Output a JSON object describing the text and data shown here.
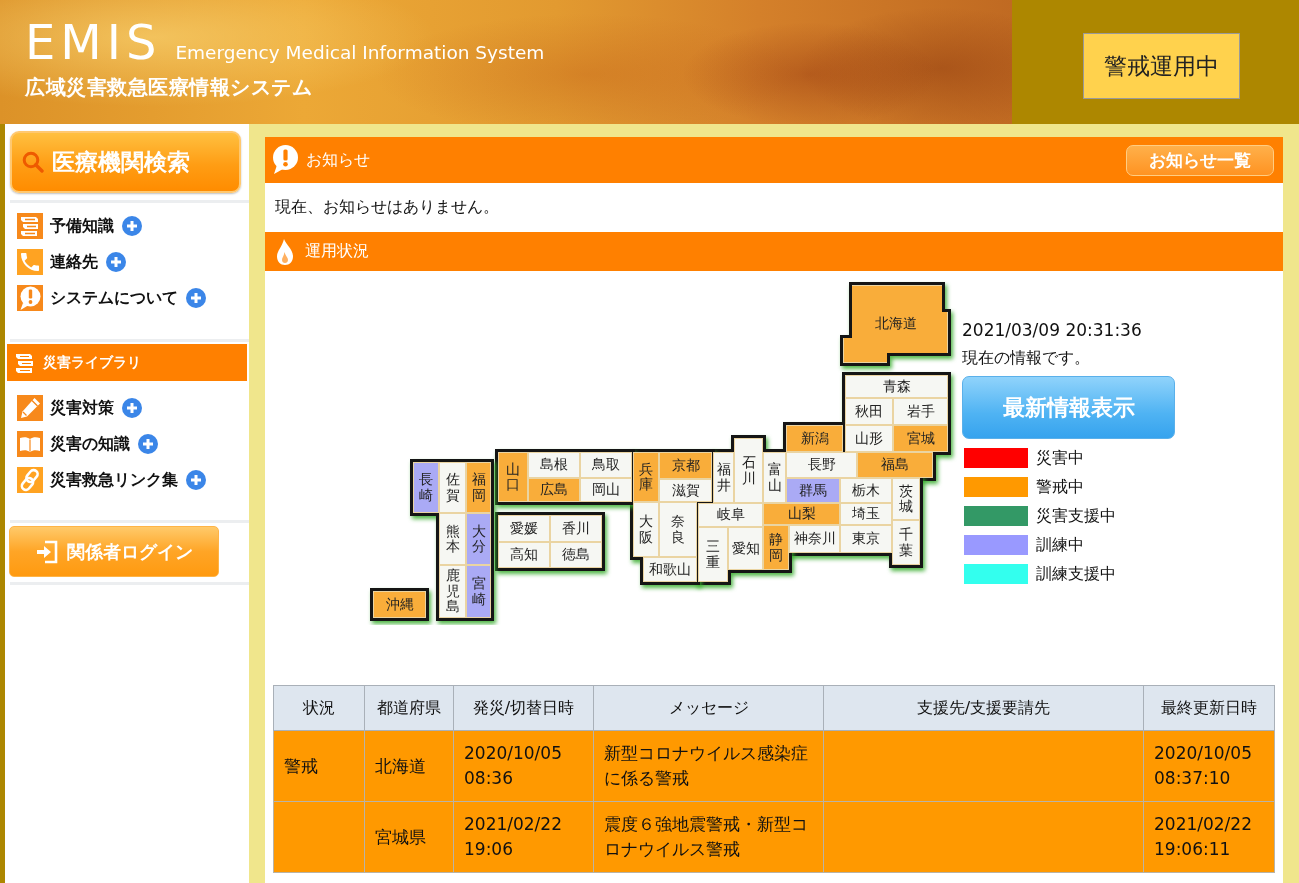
{
  "header": {
    "logo": "EMIS",
    "subtitle": "Emergency Medical Information System",
    "title": "広域災害救急医療情報システム",
    "status_badge": "警戒運用中"
  },
  "sidebar": {
    "search_button": "医療機関検索",
    "menu": [
      {
        "label": "予備知識"
      },
      {
        "label": "連絡先"
      },
      {
        "label": "システムについて"
      }
    ],
    "library": {
      "title": "災害ライブラリ",
      "items": [
        {
          "label": "災害対策"
        },
        {
          "label": "災害の知識"
        },
        {
          "label": "災害救急リンク集"
        }
      ]
    },
    "login_button": "関係者ログイン"
  },
  "notices": {
    "title": "お知らせ",
    "list_button": "お知らせ一覧",
    "message": "現在、お知らせはありません。"
  },
  "operation": {
    "title": "運用状況",
    "map": {
      "prefectures": [
        {
          "name": "北海道",
          "color": "#f9ad3a"
        },
        {
          "name": "青森",
          "color": "#f6f7f3"
        },
        {
          "name": "秋田",
          "color": "#f6f7f3"
        },
        {
          "name": "岩手",
          "color": "#f6f7f3"
        },
        {
          "name": "新潟",
          "color": "#f9ad3a"
        },
        {
          "name": "山形",
          "color": "#f6f7f3"
        },
        {
          "name": "宮城",
          "color": "#f9ad3a"
        },
        {
          "name": "長崎",
          "color": "#aaaaf5"
        },
        {
          "name": "佐賀",
          "color": "#f6f7f3"
        },
        {
          "name": "福岡",
          "color": "#f9ad3a"
        },
        {
          "name": "山口",
          "color": "#f9ad3a"
        },
        {
          "name": "島根",
          "color": "#f6f7f3"
        },
        {
          "name": "鳥取",
          "color": "#f6f7f3"
        },
        {
          "name": "兵庫",
          "color": "#f9ad3a"
        },
        {
          "name": "京都",
          "color": "#f9ad3a"
        },
        {
          "name": "福井",
          "color": "#f6f7f3"
        },
        {
          "name": "石川",
          "color": "#f6f7f3"
        },
        {
          "name": "富山",
          "color": "#f6f7f3"
        },
        {
          "name": "長野",
          "color": "#f6f7f3"
        },
        {
          "name": "福島",
          "color": "#f9ad3a"
        },
        {
          "name": "広島",
          "color": "#f9ad3a"
        },
        {
          "name": "岡山",
          "color": "#f6f7f3"
        },
        {
          "name": "滋賀",
          "color": "#f6f7f3"
        },
        {
          "name": "群馬",
          "color": "#aaaaf5"
        },
        {
          "name": "栃木",
          "color": "#f6f7f3"
        },
        {
          "name": "茨城",
          "color": "#f6f7f3"
        },
        {
          "name": "熊本",
          "color": "#f6f7f3"
        },
        {
          "name": "大分",
          "color": "#aaaaf5"
        },
        {
          "name": "愛媛",
          "color": "#f6f7f3"
        },
        {
          "name": "香川",
          "color": "#f6f7f3"
        },
        {
          "name": "大阪",
          "color": "#f6f7f3"
        },
        {
          "name": "奈良",
          "color": "#f6f7f3"
        },
        {
          "name": "岐阜",
          "color": "#f6f7f3"
        },
        {
          "name": "山梨",
          "color": "#f9ad3a"
        },
        {
          "name": "埼玉",
          "color": "#f6f7f3"
        },
        {
          "name": "高知",
          "color": "#f6f7f3"
        },
        {
          "name": "徳島",
          "color": "#f6f7f3"
        },
        {
          "name": "三重",
          "color": "#f6f7f3"
        },
        {
          "name": "愛知",
          "color": "#f6f7f3"
        },
        {
          "name": "静岡",
          "color": "#f9ad3a"
        },
        {
          "name": "神奈川",
          "color": "#f6f7f3"
        },
        {
          "name": "東京",
          "color": "#f6f7f3"
        },
        {
          "name": "千葉",
          "color": "#f6f7f3"
        },
        {
          "name": "和歌山",
          "color": "#f6f7f3"
        },
        {
          "name": "沖縄",
          "color": "#f9ad3a"
        },
        {
          "name": "鹿児島",
          "color": "#f6f7f3"
        },
        {
          "name": "宮崎",
          "color": "#aaaaf5"
        }
      ]
    },
    "timestamp": "2021/03/09 20:31:36",
    "note": "現在の情報です。",
    "refresh_button": "最新情報表示",
    "legend": [
      {
        "label": "災害中",
        "color": "#ff0000"
      },
      {
        "label": "警戒中",
        "color": "#ff9900"
      },
      {
        "label": "災害支援中",
        "color": "#339966"
      },
      {
        "label": "訓練中",
        "color": "#9999ff"
      },
      {
        "label": "訓練支援中",
        "color": "#33ffee"
      }
    ]
  },
  "table": {
    "columns": [
      "状況",
      "都道府県",
      "発災/切替日時",
      "メッセージ",
      "支援先/支援要請先",
      "最終更新日時"
    ],
    "rows": [
      {
        "status": "警戒",
        "prefecture": "北海道",
        "occurred": "2020/10/05 08:36",
        "message": "新型コロナウイルス感染症に係る警戒",
        "updated": "2020/10/05 08:37:10",
        "color": "#ff9900"
      },
      {
        "prefecture": "宮城県",
        "occurred": "2021/02/22 19:06",
        "message": "震度６強地震警戒・新型コロナウイルス警戒",
        "updated": "2021/02/22 19:06:11",
        "color": "#ff9900"
      }
    ]
  }
}
